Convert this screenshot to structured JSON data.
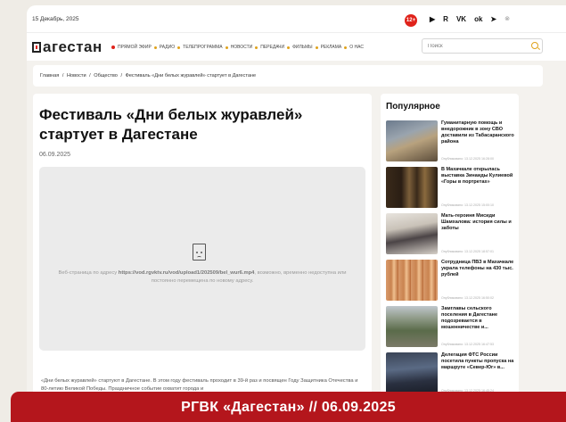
{
  "topbar": {
    "date": "15 Декабрь, 2025",
    "age_badge": "12+",
    "social_icons": [
      "youtube-icon",
      "rutube-icon",
      "vk-icon",
      "odnoklassniki-icon",
      "telegram-icon",
      "rss-icon"
    ],
    "social_glyphs": [
      "▶",
      "R",
      "VK",
      "ok",
      "➤",
      "⊗"
    ]
  },
  "header": {
    "logo_text": "агестан",
    "nav": [
      "ПРЯМОЙ ЭФИР",
      "РАДИО",
      "ТЕЛЕПРОГРАММА",
      "НОВОСТИ",
      "ПЕРЕДАЧИ",
      "ФИЛЬМЫ",
      "РЕКЛАМА",
      "О НАС"
    ],
    "search_placeholder": "Поиск"
  },
  "breadcrumb": [
    "Главная",
    "Новости",
    "Общество",
    "Фестиваль «Дни белых журавлей» стартует в Дагестане"
  ],
  "article": {
    "title": "Фестиваль «Дни белых журавлей» стартует в Дагестане",
    "date": "06.09.2025",
    "media_msg_pre": "Веб-страница по адресу ",
    "media_url": "https://vod.rgvktv.ru/vod/upload1/202509/bel_wur6.mp4",
    "media_msg_post": ", возможно, временно недоступна или постоянно перемещена по новому адресу.",
    "body": "«Дни белых журавлей» стартуют в Дагестане. В этом году фестиваль проходит в 39-й раз и посвящен Году Защитника Отечества и 80-летию Великой Победы. Праздничное событие охватит города и"
  },
  "popular": {
    "title": "Популярное",
    "items": [
      {
        "text": "Гуманитарную помощь и внедорожник в зону СВО доставили из Табасаранского района",
        "time": "Опубликовано: 13.12.2025 16:28:00"
      },
      {
        "text": "В Махачкале открылась выставка Зинаиды Кулиевой «Горы в портретах»",
        "time": "Опубликовано: 13.12.2025 15:00:10"
      },
      {
        "text": "Мать-героиня Мисиди Шамхалова: история силы и заботы",
        "time": "Опубликовано: 13.12.2025 18:57:01"
      },
      {
        "text": "Сотрудница ПВЗ в Махачкале украла телефоны на 430 тыс. рублей",
        "time": "Опубликовано: 13.12.2025 16:50:02"
      },
      {
        "text": "Замглавы сельского поселения в Дагестане подозревается в мошенничестве и...",
        "time": "Опубликовано: 13.12.2025 16:47:53"
      },
      {
        "text": "Делегация ФТС России посетила пункты пропуска на маршруте «Север-Юг» в...",
        "time": "Опубликовано: 13.12.2025 16:45:24"
      }
    ]
  },
  "banner": {
    "text": "РГВК «Дагестан» // 06.09.2025"
  }
}
